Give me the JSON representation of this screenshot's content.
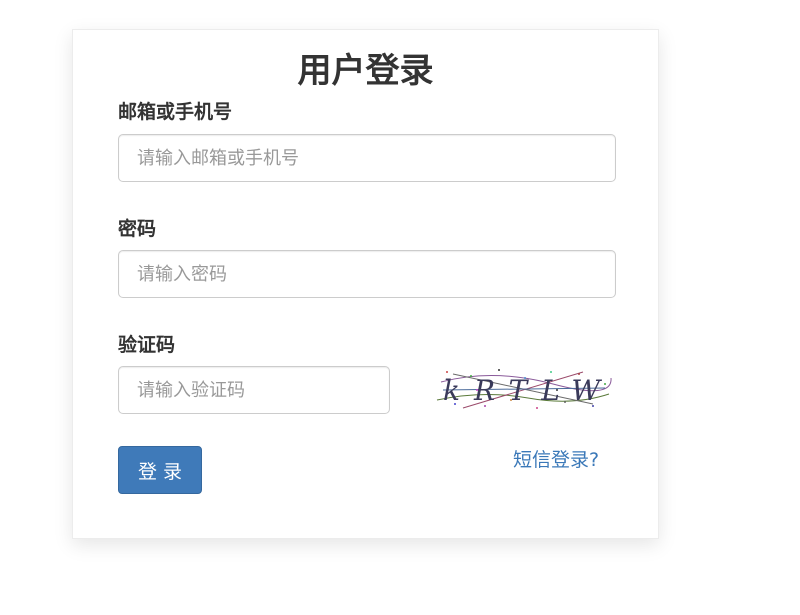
{
  "page": {
    "title": "用户登录"
  },
  "form": {
    "account": {
      "label": "邮箱或手机号",
      "placeholder": "请输入邮箱或手机号",
      "value": ""
    },
    "password": {
      "label": "密码",
      "placeholder": "请输入密码",
      "value": ""
    },
    "captcha": {
      "label": "验证码",
      "placeholder": "请输入验证码",
      "value": "",
      "image_text": "kRTLW"
    },
    "submit_label": "登 录",
    "sms_login_link": "短信登录?"
  },
  "colors": {
    "button_bg": "#3f7ab9",
    "link": "#3a78b8",
    "text": "#333333"
  }
}
